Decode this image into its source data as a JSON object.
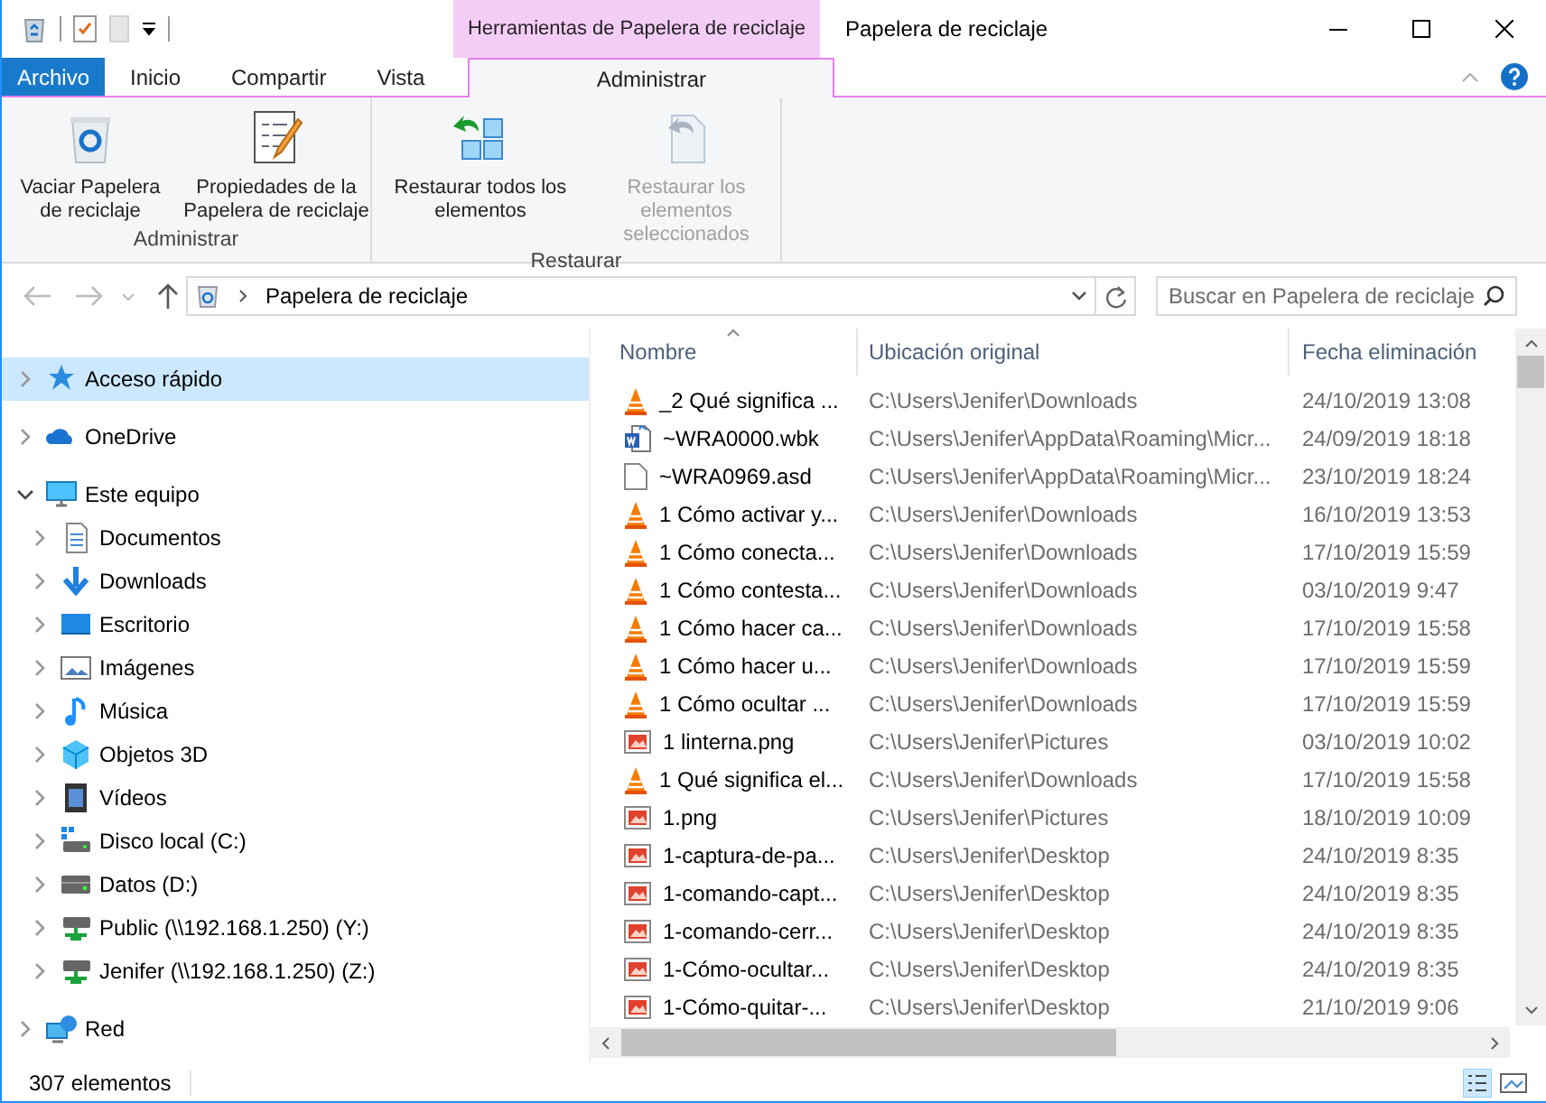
{
  "window": {
    "title": "Papelera de reciclaje",
    "contextual_tab_group": "Herramientas de Papelera de reciclaje"
  },
  "ribbon_tabs": [
    {
      "label": "Archivo",
      "kind": "file",
      "selected": false
    },
    {
      "label": "Inicio",
      "kind": "tab",
      "selected": false
    },
    {
      "label": "Compartir",
      "kind": "tab",
      "selected": false
    },
    {
      "label": "Vista",
      "kind": "tab",
      "selected": false
    },
    {
      "label": "Administrar",
      "kind": "contextual",
      "selected": true
    }
  ],
  "ribbon_groups": [
    {
      "label": "Administrar",
      "buttons": [
        {
          "label": "Vaciar Papelera de reciclaje",
          "kind": "empty-bin",
          "disabled": false
        },
        {
          "label": "Propiedades de la Papelera de reciclaje",
          "kind": "properties",
          "disabled": false
        }
      ]
    },
    {
      "label": "Restaurar",
      "buttons": [
        {
          "label": "Restaurar todos los elementos",
          "kind": "restore-all",
          "disabled": false
        },
        {
          "label": "Restaurar los elementos seleccionados",
          "kind": "restore-selected",
          "disabled": true
        }
      ]
    }
  ],
  "address": {
    "path": "Papelera de reciclaje"
  },
  "search": {
    "placeholder": "Buscar en Papelera de reciclaje"
  },
  "nav_tree": [
    {
      "label": "Acceso rápido",
      "kind": "star",
      "expanded": false,
      "selected": true
    },
    {
      "label": "OneDrive",
      "kind": "cloud",
      "expanded": false,
      "selected": false
    },
    {
      "label": "Este equipo",
      "kind": "computer",
      "expanded": true,
      "selected": false,
      "children": [
        {
          "label": "Documentos",
          "kind": "documents",
          "expanded": false,
          "selected": false
        },
        {
          "label": "Downloads",
          "kind": "download",
          "expanded": false,
          "selected": false
        },
        {
          "label": "Escritorio",
          "kind": "desktop",
          "expanded": false,
          "selected": false
        },
        {
          "label": "Imágenes",
          "kind": "pictures",
          "expanded": false,
          "selected": false
        },
        {
          "label": "Música",
          "kind": "music",
          "expanded": false,
          "selected": false
        },
        {
          "label": "Objetos 3D",
          "kind": "cube",
          "expanded": false,
          "selected": false
        },
        {
          "label": "Vídeos",
          "kind": "videos",
          "expanded": false,
          "selected": false
        },
        {
          "label": "Disco local (C:)",
          "kind": "system-drive",
          "expanded": false,
          "selected": false
        },
        {
          "label": "Datos (D:)",
          "kind": "drive",
          "expanded": false,
          "selected": false
        },
        {
          "label": "Public (\\\\192.168.1.250) (Y:)",
          "kind": "network-drive",
          "expanded": false,
          "selected": false
        },
        {
          "label": "Jenifer (\\\\192.168.1.250) (Z:)",
          "kind": "network-drive",
          "expanded": false,
          "selected": false
        }
      ]
    },
    {
      "label": "Red",
      "kind": "network",
      "expanded": false,
      "selected": false
    }
  ],
  "file_list": {
    "columns": [
      {
        "label": "Nombre",
        "sorted": true
      },
      {
        "label": "Ubicación original",
        "sorted": false
      },
      {
        "label": "Fecha eliminación",
        "sorted": false
      }
    ],
    "rows": [
      {
        "kind": "video",
        "name": "_2 Qué significa ...",
        "location": "C:\\Users\\Jenifer\\Downloads",
        "date": "24/10/2019 13:08"
      },
      {
        "kind": "word-backup",
        "name": "~WRA0000.wbk",
        "location": "C:\\Users\\Jenifer\\AppData\\Roaming\\Micr...",
        "date": "24/09/2019 18:18"
      },
      {
        "kind": "blank",
        "name": "~WRA0969.asd",
        "location": "C:\\Users\\Jenifer\\AppData\\Roaming\\Micr...",
        "date": "23/10/2019 18:24"
      },
      {
        "kind": "video",
        "name": "1 Cómo activar y...",
        "location": "C:\\Users\\Jenifer\\Downloads",
        "date": "16/10/2019 13:53"
      },
      {
        "kind": "video",
        "name": "1 Cómo conecta...",
        "location": "C:\\Users\\Jenifer\\Downloads",
        "date": "17/10/2019 15:59"
      },
      {
        "kind": "video",
        "name": "1 Cómo contesta...",
        "location": "C:\\Users\\Jenifer\\Downloads",
        "date": "03/10/2019 9:47"
      },
      {
        "kind": "video",
        "name": "1 Cómo hacer ca...",
        "location": "C:\\Users\\Jenifer\\Downloads",
        "date": "17/10/2019 15:58"
      },
      {
        "kind": "video",
        "name": "1 Cómo hacer u...",
        "location": "C:\\Users\\Jenifer\\Downloads",
        "date": "17/10/2019 15:59"
      },
      {
        "kind": "video",
        "name": "1 Cómo ocultar ...",
        "location": "C:\\Users\\Jenifer\\Downloads",
        "date": "17/10/2019 15:59"
      },
      {
        "kind": "image",
        "name": "1 linterna.png",
        "location": "C:\\Users\\Jenifer\\Pictures",
        "date": "03/10/2019 10:02"
      },
      {
        "kind": "video",
        "name": "1 Qué significa el...",
        "location": "C:\\Users\\Jenifer\\Downloads",
        "date": "17/10/2019 15:58"
      },
      {
        "kind": "image",
        "name": "1.png",
        "location": "C:\\Users\\Jenifer\\Pictures",
        "date": "18/10/2019 10:09"
      },
      {
        "kind": "image",
        "name": "1-captura-de-pa...",
        "location": "C:\\Users\\Jenifer\\Desktop",
        "date": "24/10/2019 8:35"
      },
      {
        "kind": "image",
        "name": "1-comando-capt...",
        "location": "C:\\Users\\Jenifer\\Desktop",
        "date": "24/10/2019 8:35"
      },
      {
        "kind": "image",
        "name": "1-comando-cerr...",
        "location": "C:\\Users\\Jenifer\\Desktop",
        "date": "24/10/2019 8:35"
      },
      {
        "kind": "image",
        "name": "1-Cómo-ocultar...",
        "location": "C:\\Users\\Jenifer\\Desktop",
        "date": "24/10/2019 8:35"
      },
      {
        "kind": "image",
        "name": "1-Cómo-quitar-...",
        "location": "C:\\Users\\Jenifer\\Desktop",
        "date": "21/10/2019 9:06"
      }
    ]
  },
  "status_bar": {
    "item_count": "307 elementos"
  }
}
